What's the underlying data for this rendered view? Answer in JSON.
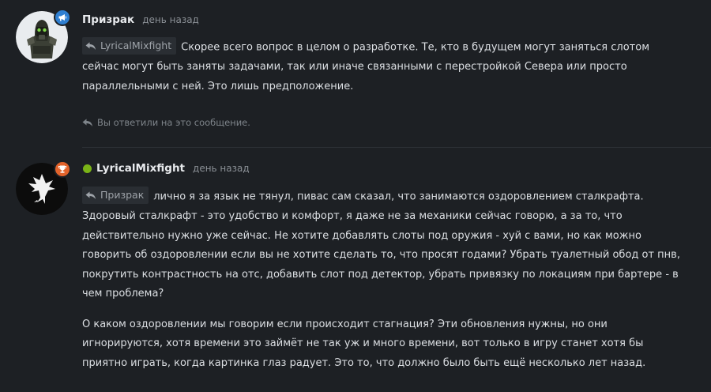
{
  "comments": [
    {
      "author": "Призрак",
      "time": "день назад",
      "badge_icon": "megaphone-icon",
      "badge_color": "#2f7fd1",
      "quote_author": "LyricalMixfight",
      "text": "Скорее всего вопрос в целом о разработке. Те, кто в будущем могут заняться слотом сейчас могут быть заняты задачами, так или иначе связанными с перестройкой Севера или просто параллельными с ней. Это лишь предположение.",
      "reply_note": "Вы ответили на это сообщение."
    },
    {
      "author": "LyricalMixfight",
      "time": "день назад",
      "online_color": "#7ab317",
      "badge_icon": "trophy-icon",
      "badge_color": "#e2632b",
      "quote_author": "Призрак",
      "text_p1": "лично я за язык не тянул, пивас сам сказал, что занимаются оздоровлением сталкрафта. Здоровый сталкрафт - это удобство и комфорт, я даже не за механики сейчас говорю, а за то, что действительно нужно уже сейчас. Не хотите добавлять слоты под оружия - хуй с вами, но как можно говорить об оздоровлении если вы не хотите сделать то, что просят годами? Убрать туалетный обод от пнв, покрутить контрастность на отс, добавить слот под детектор, убрать привязку по локациям при бартере - в чем проблема?",
      "text_p2": "О каком оздоровлении мы говорим если происходит стагнация? Эти обновления нужны, но они игнорируются, хотя времени это займёт не так уж и много времени, вот только в игру станет хотя бы приятно играть, когда картинка глаз радует. Это то, что должно было быть ещё несколько лет назад."
    }
  ]
}
